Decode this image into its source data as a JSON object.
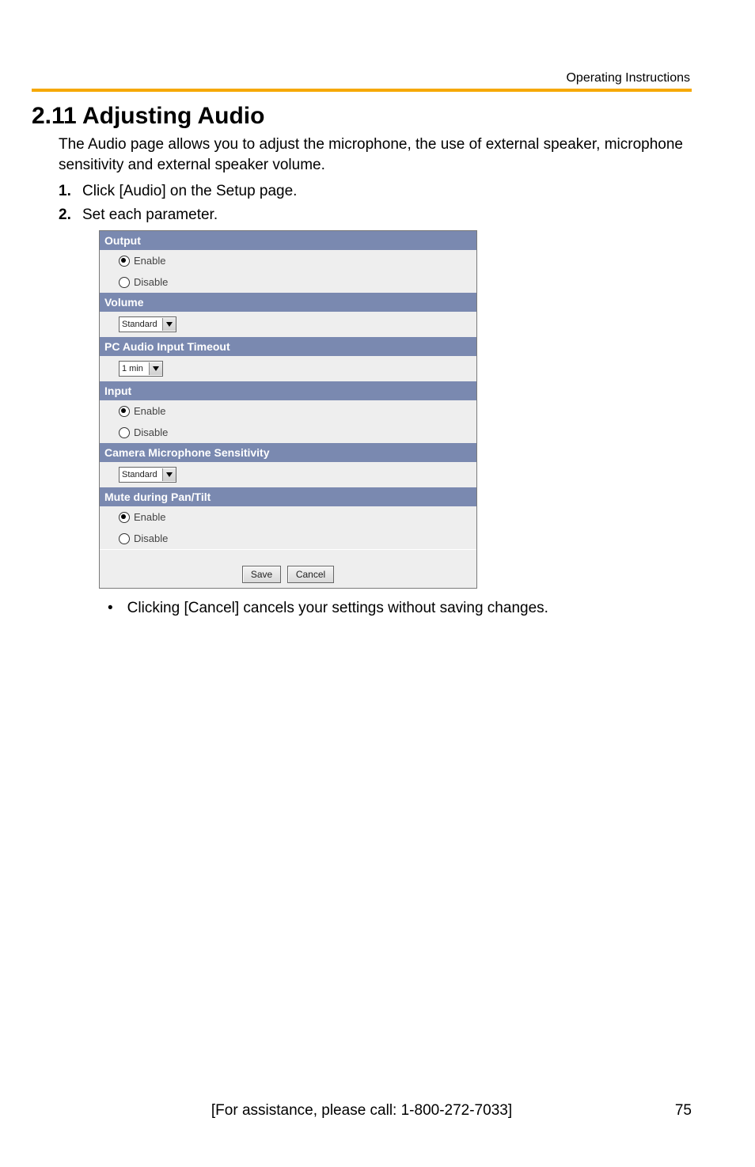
{
  "header": {
    "label": "Operating Instructions"
  },
  "title": "2.11  Adjusting Audio",
  "intro": "The Audio page allows you to adjust the microphone, the use of external speaker, microphone sensitivity and external speaker volume.",
  "steps": [
    {
      "num": "1.",
      "text": "Click [Audio] on the Setup page."
    },
    {
      "num": "2.",
      "text": "Set each parameter."
    }
  ],
  "form": {
    "sections": {
      "output": {
        "title": "Output",
        "enable": "Enable",
        "disable": "Disable"
      },
      "volume": {
        "title": "Volume",
        "value": "Standard"
      },
      "pc_timeout": {
        "title": "PC Audio Input Timeout",
        "value": "1 min"
      },
      "input": {
        "title": "Input",
        "enable": "Enable",
        "disable": "Disable"
      },
      "mic_sens": {
        "title": "Camera Microphone Sensitivity",
        "value": "Standard"
      },
      "mute_pt": {
        "title": "Mute during Pan/Tilt",
        "enable": "Enable",
        "disable": "Disable"
      }
    },
    "buttons": {
      "save": "Save",
      "cancel": "Cancel"
    }
  },
  "note": "Clicking [Cancel] cancels your settings without saving changes.",
  "footer": {
    "assist": "[For assistance, please call: 1-800-272-7033]",
    "page": "75"
  }
}
